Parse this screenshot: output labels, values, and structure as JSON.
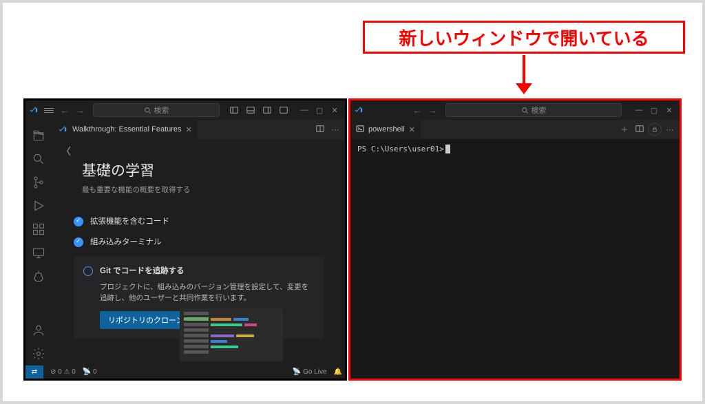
{
  "callout_text": "新しいウィンドウで開いている",
  "left": {
    "search_placeholder": "検索",
    "tab_title": "Walkthrough: Essential Features",
    "walkthrough": {
      "heading": "基礎の学習",
      "subheading": "最も重要な機能の概要を取得する",
      "step1": "拡張機能を含むコード",
      "step2": "組み込みターミナル",
      "step3_title": "Git でコードを追跡する",
      "step3_desc": "プロジェクトに、組み込みのバージョン管理を設定して、変更を追跡し、他のユーザーと共同作業を行います。",
      "step3_button": "リポジトリのクローン"
    },
    "status": {
      "errors": "0",
      "warnings": "0",
      "ports": "0",
      "golive": "Go Live"
    }
  },
  "right": {
    "search_placeholder": "検索",
    "tab_title": "powershell",
    "prompt": "PS C:\\Users\\user01>"
  }
}
